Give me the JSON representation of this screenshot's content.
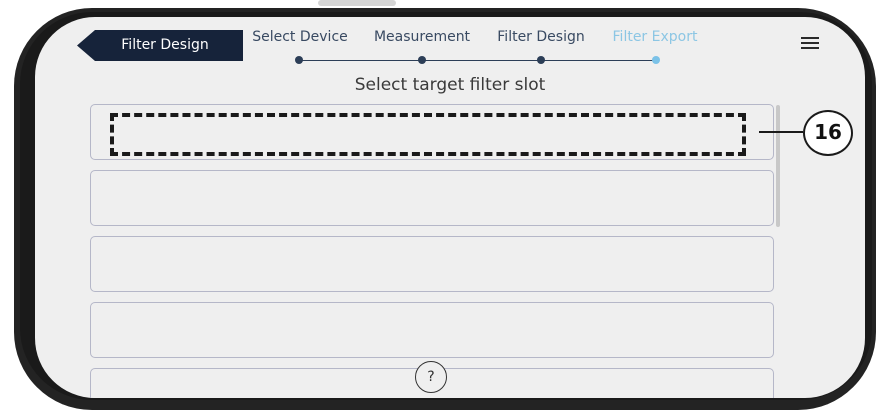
{
  "nav": {
    "back_label": "Filter Design",
    "steps": [
      {
        "label": "Select Device"
      },
      {
        "label": "Measurement"
      },
      {
        "label": "Filter Design"
      },
      {
        "label": "Filter Export"
      }
    ],
    "active_step": "Filter Export",
    "menu_icon": "hamburger-menu-icon"
  },
  "main": {
    "title": "Select target filter slot",
    "slots": [
      {
        "label": ""
      },
      {
        "label": ""
      },
      {
        "label": ""
      },
      {
        "label": ""
      },
      {
        "label": ""
      }
    ]
  },
  "help": {
    "label": "?"
  },
  "annotation": {
    "badge": "16"
  },
  "colors": {
    "nav_bg": "#16233a",
    "active_step": "#8cc6e4",
    "step_text": "#394a62"
  }
}
